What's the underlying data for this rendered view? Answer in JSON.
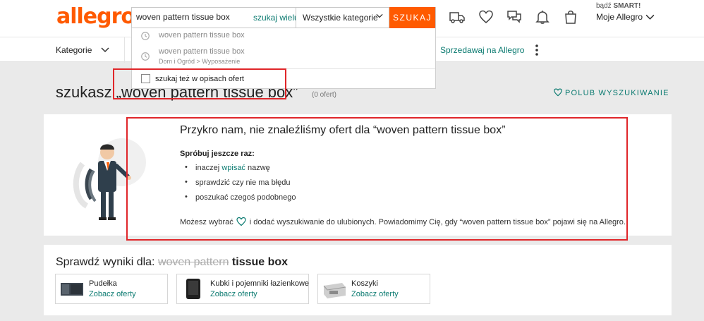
{
  "header": {
    "logo": "allegro",
    "search_value": "woven pattern tissue box",
    "search_many": "szukaj wielu",
    "category_select": "Wszystkie kategorie",
    "search_button": "SZUKAJ",
    "smart_prefix": "bądź",
    "smart_label": "SMART!",
    "account_label": "Moje Allegro"
  },
  "navbar": {
    "categories": "Kategorie",
    "sell": "Sprzedawaj na Allegro"
  },
  "dropdown": {
    "suggestions": [
      {
        "text": "woven pattern tissue box",
        "sub": ""
      },
      {
        "text": "woven pattern tissue box",
        "sub": "Dom i Ogród > Wyposażenie"
      }
    ],
    "checkbox_label": "szukaj też w opisach ofert"
  },
  "results": {
    "title": "szukasz „woven pattern tissue box”",
    "count": "(0 ofert)",
    "like_search": "POLUB WYSZUKIWANIE"
  },
  "no_results": {
    "title": "Przykro nam, nie znaleźliśmy ofert dla “woven pattern tissue box”",
    "try_again": "Spróbuj jeszcze raz:",
    "tip1_prefix": "inaczej",
    "tip1_link": "wpisać",
    "tip1_suffix": "nazwę",
    "tip2": "sprawdzić czy nie ma błędu",
    "tip3": "poszukać czegoś podobnego",
    "fav_prefix": "Możesz wybrać",
    "fav_suffix": "i dodać wyszukiwanie do ulubionych. Powiadomimy Cię, gdy “woven pattern tissue box” pojawi się na Allegro."
  },
  "check_results": {
    "label": "Sprawdź wyniki dla:",
    "strike": "woven pattern",
    "rest": "tissue box",
    "tiles": [
      {
        "name": "Pudełka",
        "link": "Zobacz oferty"
      },
      {
        "name": "Kubki i pojemniki łazienkowe",
        "link": "Zobacz oferty"
      },
      {
        "name": "Koszyki",
        "link": "Zobacz oferty"
      }
    ]
  },
  "colors": {
    "brand": "#ff5a00",
    "link": "#0a7a70",
    "highlight": "#e0262a"
  }
}
